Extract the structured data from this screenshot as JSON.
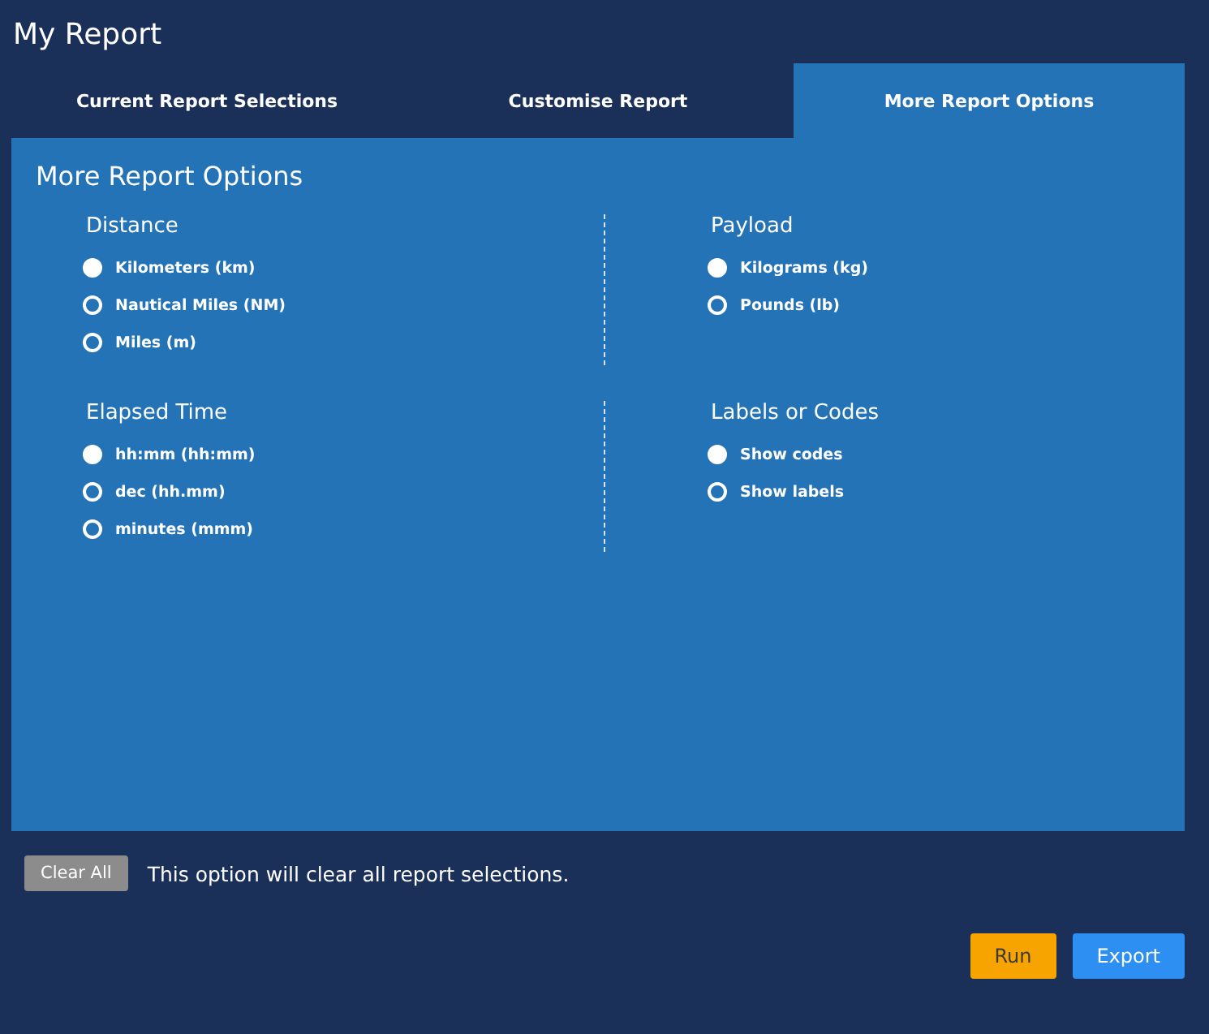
{
  "window": {
    "title": "My Report"
  },
  "tabs": [
    {
      "label": "Current Report Selections",
      "selected": false
    },
    {
      "label": "Customise Report",
      "selected": false
    },
    {
      "label": "More Report Options",
      "selected": true
    }
  ],
  "panel": {
    "title": "More Report Options",
    "groups": [
      {
        "title": "Distance",
        "options": [
          {
            "label": "Kilometers (km)",
            "selected": true
          },
          {
            "label": "Nautical Miles (NM)",
            "selected": false
          },
          {
            "label": "Miles (m)",
            "selected": false
          }
        ]
      },
      {
        "title": "Payload",
        "options": [
          {
            "label": "Kilograms (kg)",
            "selected": true
          },
          {
            "label": "Pounds (lb)",
            "selected": false
          }
        ]
      },
      {
        "title": "Elapsed Time",
        "options": [
          {
            "label": "hh:mm (hh:mm)",
            "selected": true
          },
          {
            "label": "dec (hh.mm)",
            "selected": false
          },
          {
            "label": "minutes (mmm)",
            "selected": false
          }
        ]
      },
      {
        "title": "Labels or Codes",
        "options": [
          {
            "label": "Show codes",
            "selected": true
          },
          {
            "label": "Show labels",
            "selected": false
          }
        ]
      }
    ]
  },
  "clear": {
    "button": "Clear All",
    "note": "This option will clear all report selections."
  },
  "buttons": [
    {
      "label": "Run",
      "kind": "primary"
    },
    {
      "label": "Export",
      "kind": "secondary"
    }
  ]
}
